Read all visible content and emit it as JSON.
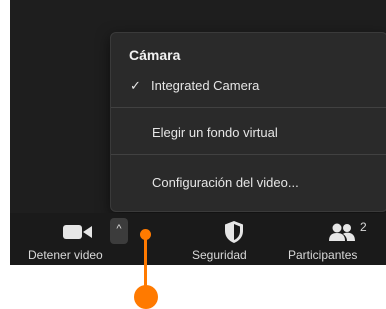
{
  "menu": {
    "header": "Cámara",
    "items": [
      {
        "label": "Integrated Camera",
        "checked": true
      },
      {
        "label": "Elegir un fondo virtual"
      },
      {
        "label": "Configuración del video..."
      }
    ],
    "check_glyph": "✓"
  },
  "toolbar": {
    "video": {
      "label": "Detener video",
      "icon": "video-camera-icon",
      "caret": "^"
    },
    "security": {
      "label": "Seguridad",
      "icon": "shield-icon"
    },
    "participants": {
      "label": "Participantes",
      "icon": "people-icon",
      "count": "2"
    }
  },
  "colors": {
    "window_bg": "#1e1e1e",
    "menu_bg": "#2a2a2a",
    "callout": "#ff7a00"
  }
}
